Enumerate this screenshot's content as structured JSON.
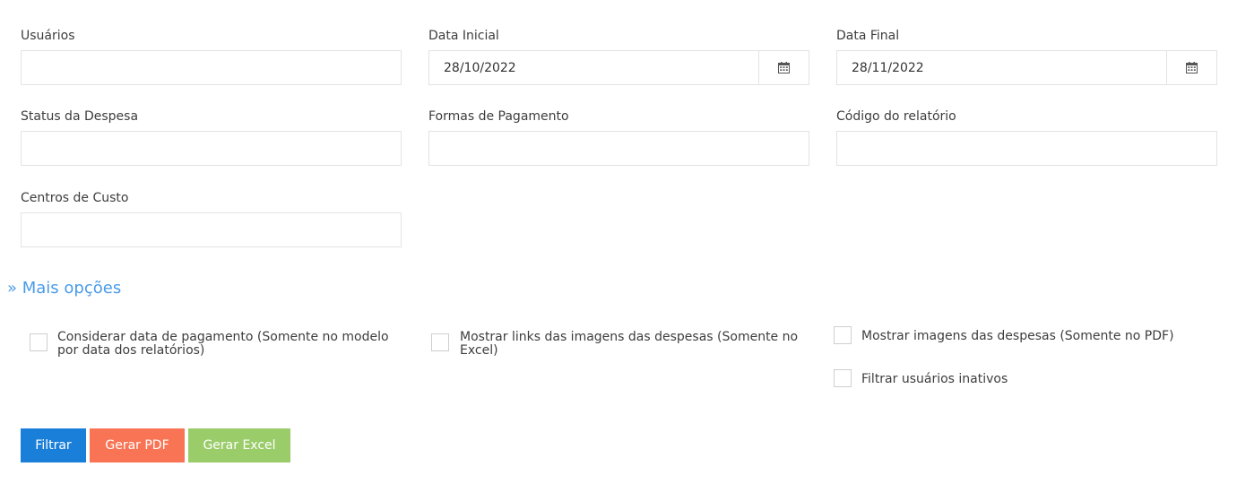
{
  "fields": {
    "usuarios": {
      "label": "Usuários",
      "value": ""
    },
    "data_inicial": {
      "label": "Data Inicial",
      "value": "28/10/2022"
    },
    "data_final": {
      "label": "Data Final",
      "value": "28/11/2022"
    },
    "status_despesa": {
      "label": "Status da Despesa",
      "value": ""
    },
    "formas_pagamento": {
      "label": "Formas de Pagamento",
      "value": ""
    },
    "codigo_relatorio": {
      "label": "Código do relatório",
      "value": ""
    },
    "centros_custo": {
      "label": "Centros de Custo",
      "value": ""
    }
  },
  "more_options": {
    "label": "» Mais opções"
  },
  "options": {
    "considerar_data_pagamento": {
      "label": "Considerar data de pagamento (Somente no modelo por data dos relatórios)",
      "checked": false
    },
    "mostrar_links_imagens": {
      "label": "Mostrar links das imagens das despesas (Somente no Excel)",
      "checked": false
    },
    "mostrar_imagens": {
      "label": "Mostrar imagens das despesas (Somente no PDF)",
      "checked": false
    },
    "filtrar_inativos": {
      "label": "Filtrar usuários inativos",
      "checked": false
    }
  },
  "buttons": {
    "filtrar": {
      "label": "Filtrar",
      "color": "#1a7fd9"
    },
    "gerar_pdf": {
      "label": "Gerar PDF",
      "color": "#f97455"
    },
    "gerar_excel": {
      "label": "Gerar Excel",
      "color": "#9acc6a"
    }
  },
  "icons": {
    "date_picker": "calendar-icon"
  },
  "colors": {
    "link": "#4a9be8",
    "border": "#e3e3e3"
  }
}
